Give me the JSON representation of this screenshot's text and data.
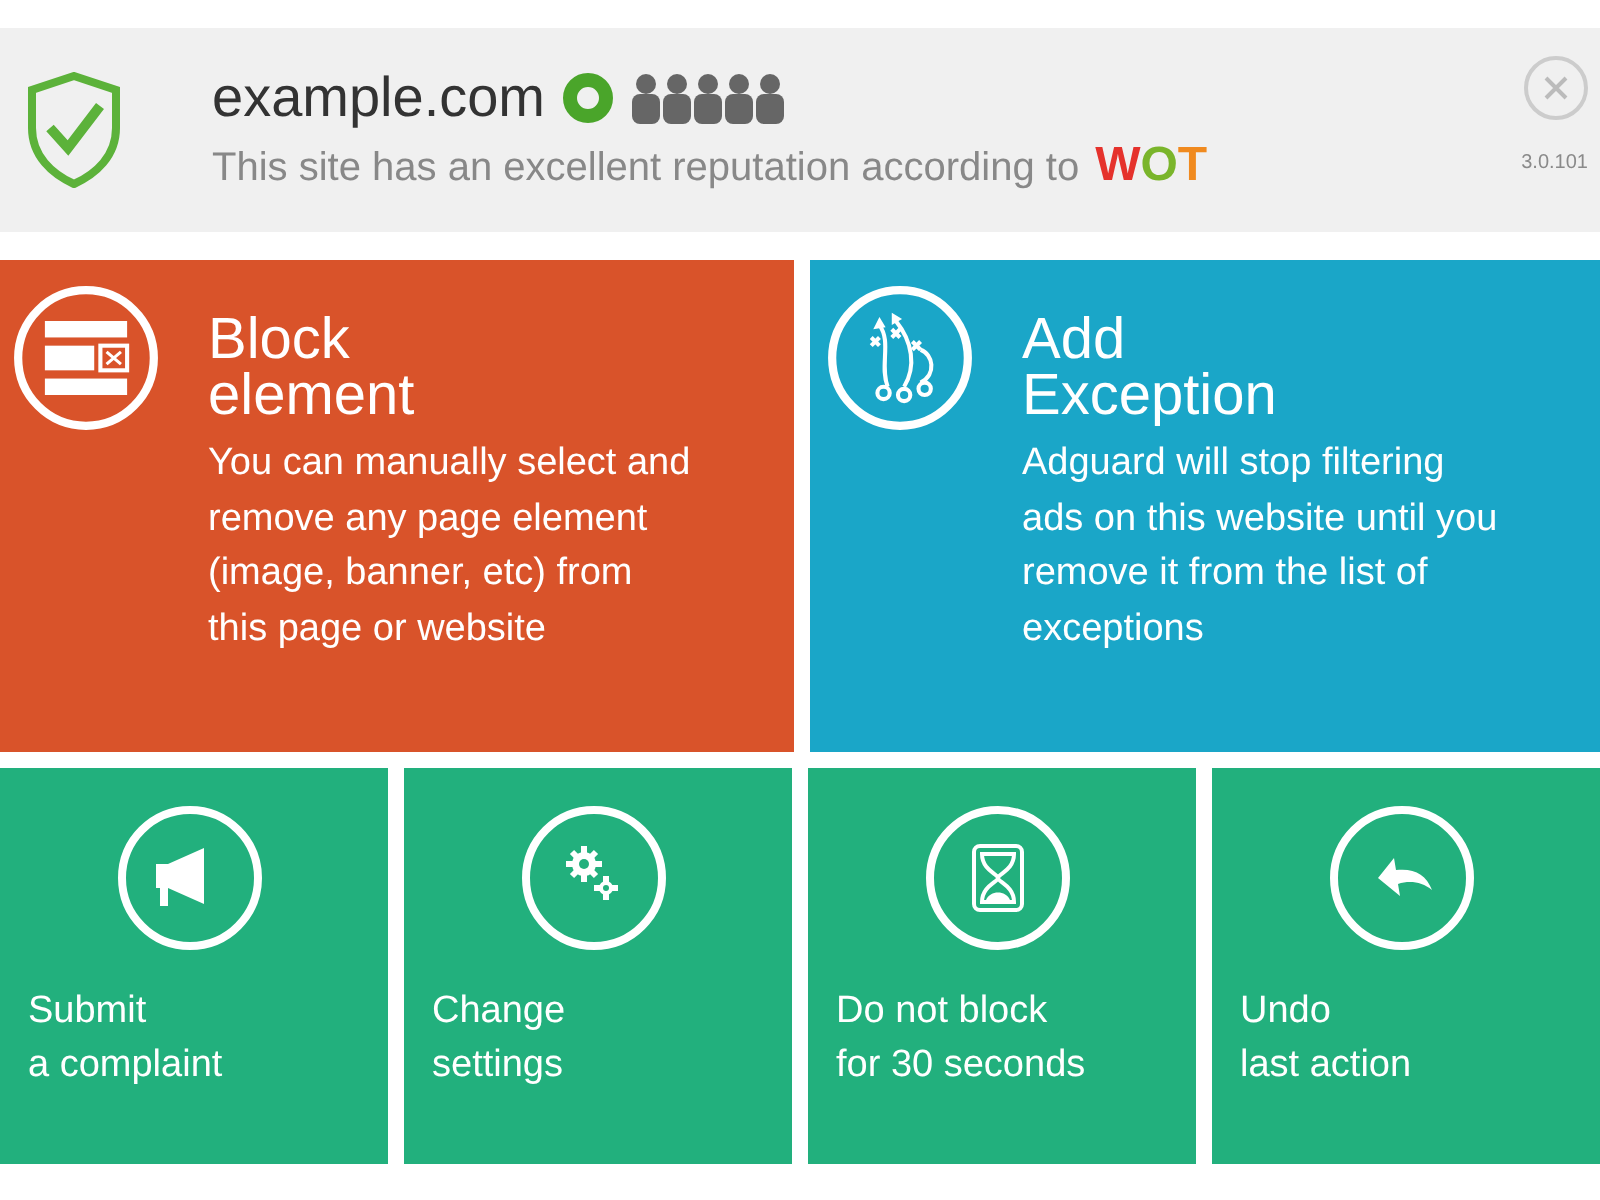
{
  "header": {
    "site": "example.com",
    "reputation": "This site has an excellent reputation according to",
    "provider": "WOT",
    "version": "3.0.101"
  },
  "main_tiles": [
    {
      "title": "Block\nelement",
      "description": "You can manually select and remove any page element (image, banner, etc) from this page or website",
      "color": "#d9532a"
    },
    {
      "title": "Add\nException",
      "description": "Adguard will stop filtering ads on this website until you remove it from the list of exceptions",
      "color": "#1aa6c8"
    }
  ],
  "small_tiles": [
    {
      "label": "Submit\na complaint"
    },
    {
      "label": "Change\nsettings"
    },
    {
      "label": "Do not block\nfor 30 seconds"
    },
    {
      "label": "Undo\nlast action"
    }
  ]
}
